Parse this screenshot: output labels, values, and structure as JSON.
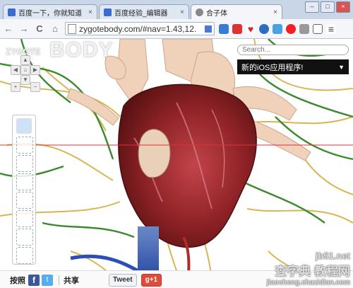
{
  "browser": {
    "tabs": [
      {
        "label": "百度一下，你就知道",
        "close": "×"
      },
      {
        "label": "百度经验_编辑器",
        "close": "×"
      },
      {
        "label": "合子体",
        "close": "×"
      }
    ],
    "window_controls": {
      "minimize": "–",
      "maximize": "□",
      "close": "×"
    },
    "back": "←",
    "forward": "→",
    "reload": "C",
    "home": "⌂",
    "url": "zygotebody.com/#nav=1.43,12.",
    "accent": "#3b6ad1"
  },
  "app": {
    "logo_small": "ZYGOTE",
    "logo_big": "BODY",
    "search_placeholder": "Search...",
    "banner_text": "新的iOS应用程序!",
    "banner_caret": "▼",
    "nav_labels": {
      "up": "▲",
      "left": "◀",
      "center": "⌂",
      "right": "▶",
      "down": "▼",
      "zoom_in": "+",
      "zoom_out": "−"
    },
    "layers": [
      "full-body-icon",
      "skeleton-icon",
      "muscle-icon",
      "bone-icon",
      "organ-icon",
      "vessel-icon",
      "nerve-icon",
      "skin-icon"
    ]
  },
  "footer": {
    "label": "按照",
    "facebook": "f",
    "twitter": "t",
    "share": "共享",
    "tweet": "Tweet",
    "gplus": "g+1"
  },
  "watermark": {
    "line1": "查字典 教程网",
    "line2": "jiaocheng.chazidian.com",
    "site": "jb51.net"
  }
}
